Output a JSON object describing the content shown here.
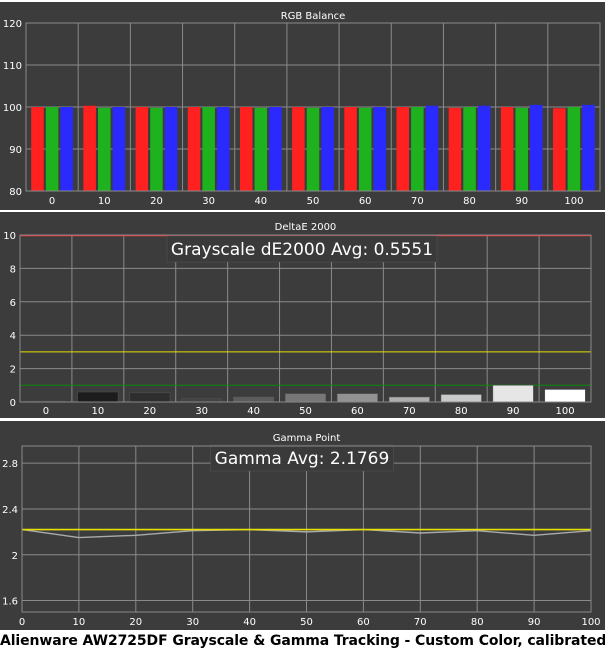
{
  "caption": "Alienware AW2725DF Grayscale & Gamma Tracking - Custom Color, calibrated",
  "colors": {
    "background": "#3c3c3c",
    "grid": "#8a8a8a",
    "text": "#ffffff",
    "red": "#ff2020",
    "green": "#1fb21f",
    "blue": "#2a2aff",
    "yellow": "#e6e000",
    "gray": "#aaaaaa",
    "darkgreen": "#0a8a0a",
    "red_line": "#ff3030"
  },
  "chart_data": [
    {
      "type": "bar",
      "title": "RGB Balance",
      "categories": [
        "0",
        "10",
        "20",
        "30",
        "40",
        "50",
        "60",
        "70",
        "80",
        "90",
        "100"
      ],
      "yticks": [
        "80",
        "90",
        "100",
        "110",
        "120"
      ],
      "ylim": [
        80,
        120
      ],
      "series": [
        {
          "color": "red",
          "values": [
            100,
            100.3,
            100,
            100,
            100,
            100,
            100,
            100,
            99.8,
            100,
            99.7
          ]
        },
        {
          "color": "green",
          "values": [
            100,
            99.8,
            99.8,
            100,
            99.8,
            99.8,
            99.8,
            100,
            100,
            99.8,
            100
          ]
        },
        {
          "color": "blue",
          "values": [
            100,
            100,
            100,
            100,
            100,
            100,
            100,
            100.3,
            100.3,
            100.5,
            100.5
          ]
        }
      ]
    },
    {
      "type": "bar",
      "title": "DeltaE 2000",
      "annotation": "Grayscale dE2000 Avg: 0.5551",
      "categories": [
        "0",
        "10",
        "20",
        "30",
        "40",
        "50",
        "60",
        "70",
        "80",
        "90",
        "100"
      ],
      "values": [
        0.05,
        0.6,
        0.55,
        0.2,
        0.3,
        0.5,
        0.5,
        0.3,
        0.45,
        1.0,
        0.75
      ],
      "bar_colors": [
        "#0d0d0d",
        "#1c1c1c",
        "#2e2e2e",
        "#444444",
        "#5c5c5c",
        "#777777",
        "#929292",
        "#aeaeae",
        "#cacaca",
        "#e6e6e6",
        "#ffffff"
      ],
      "yticks": [
        "0",
        "2",
        "4",
        "6",
        "8",
        "10"
      ],
      "ylim": [
        0,
        10
      ],
      "thresholds": [
        1,
        3
      ]
    },
    {
      "type": "line",
      "title": "Gamma Point",
      "annotation": "Gamma Avg: 2.1769",
      "x": [
        0,
        10,
        20,
        30,
        40,
        50,
        60,
        70,
        80,
        90,
        100
      ],
      "xticks": [
        "0",
        "10",
        "20",
        "30",
        "40",
        "50",
        "60",
        "70",
        "80",
        "90",
        "100"
      ],
      "yticks": [
        "1.6",
        "2",
        "2.4",
        "2.8"
      ],
      "ylim": [
        1.5,
        2.95
      ],
      "series": [
        {
          "color": "gray",
          "values": [
            2.22,
            2.15,
            2.17,
            2.21,
            2.22,
            2.2,
            2.22,
            2.19,
            2.21,
            2.17,
            2.21
          ]
        },
        {
          "color": "yellow",
          "values": [
            2.22,
            2.22,
            2.22,
            2.22,
            2.22,
            2.22,
            2.22,
            2.22,
            2.22,
            2.22,
            2.22
          ]
        }
      ]
    }
  ]
}
